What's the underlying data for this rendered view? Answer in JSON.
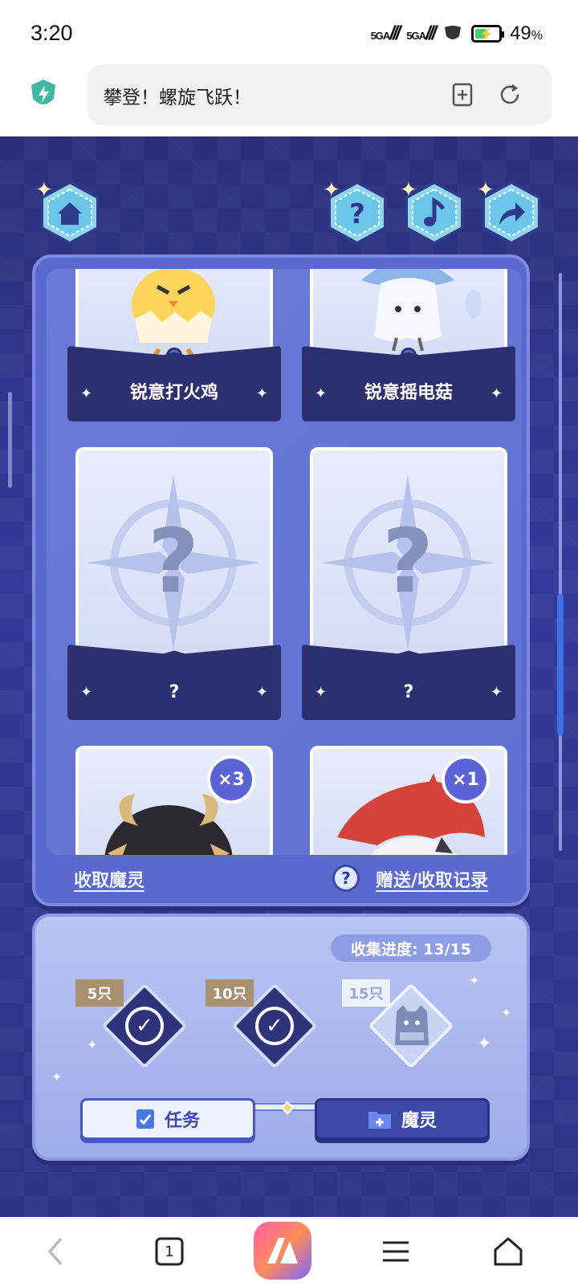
{
  "status_bar": {
    "time": "3:20",
    "signal1": "5GA",
    "signal2": "5GA",
    "battery_pct": "49",
    "battery_unit": "%"
  },
  "address_bar": {
    "page_title": "攀登！螺旋飞跃！"
  },
  "game": {
    "cards": [
      {
        "name": "锐意打火鸡"
      },
      {
        "name": "锐意摇电菇"
      },
      {
        "name": "?"
      },
      {
        "name": "?"
      },
      {
        "name": "",
        "count": "×3"
      },
      {
        "name": "",
        "count": "×1"
      }
    ],
    "footer": {
      "collect_link": "收取魔灵",
      "help_mark": "?",
      "record_link": "赠送/收取记录"
    },
    "progress": {
      "title": "收集进度: 13/15",
      "value": 13,
      "max": 15,
      "milestones": [
        {
          "label": "5只",
          "achieved": true
        },
        {
          "label": "10只",
          "achieved": true
        },
        {
          "label": "15只",
          "achieved": false
        }
      ],
      "task_button": "任务",
      "spirit_button": "魔灵"
    }
  },
  "nav": {
    "tab_count": "1"
  },
  "colors": {
    "accent": "#5b69cf",
    "background": "#2d3386"
  }
}
